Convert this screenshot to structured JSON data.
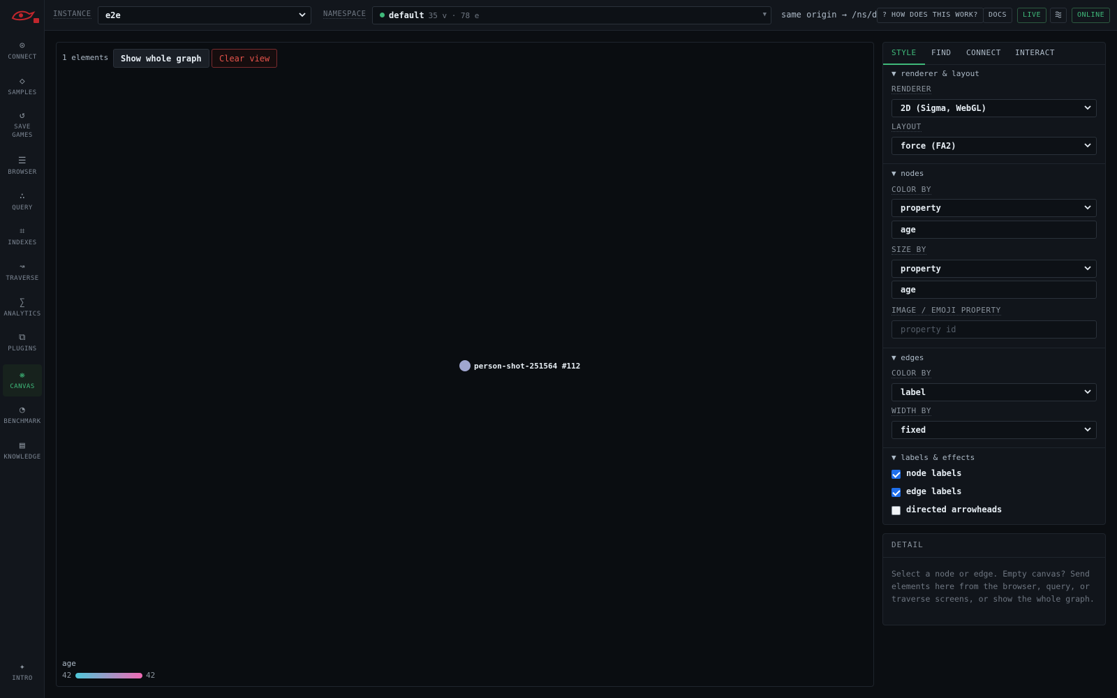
{
  "sidebar": {
    "items": [
      {
        "label": "CONNECT",
        "icon": "target-icon"
      },
      {
        "label": "SAMPLES",
        "icon": "diamond-icon"
      },
      {
        "label": "SAVE GAMES",
        "icon": "refresh-icon"
      },
      {
        "label": "BROWSER",
        "icon": "list-icon"
      },
      {
        "label": "QUERY",
        "icon": "dots-icon"
      },
      {
        "label": "INDEXES",
        "icon": "frame-icon"
      },
      {
        "label": "TRAVERSE",
        "icon": "squiggle-icon"
      },
      {
        "label": "ANALYTICS",
        "icon": "sigma-icon"
      },
      {
        "label": "PLUGINS",
        "icon": "copy-icon"
      },
      {
        "label": "CANVAS",
        "icon": "canvas-icon"
      },
      {
        "label": "BENCHMARK",
        "icon": "gauge-icon"
      },
      {
        "label": "KNOWLEDGE",
        "icon": "book-icon"
      }
    ],
    "intro": {
      "label": "INTRO",
      "icon": "sparkle-icon"
    }
  },
  "topbar": {
    "instance_label": "INSTANCE",
    "instance_value": "e2e",
    "namespace_label": "NAMESPACE",
    "namespace_value": "default",
    "namespace_counts": "35 v · 78 e",
    "origin": "same origin → /ns/default/*",
    "help": "? HOW DOES THIS WORK?",
    "docs": "DOCS",
    "live": "LIVE",
    "online": "ONLINE",
    "accent": "#3fb97a"
  },
  "canvas": {
    "element_count": "1 elements",
    "show_whole_graph": "Show whole graph",
    "clear_view": "Clear view",
    "node_label": "person-shot-251564 #112",
    "legend": {
      "title": "age",
      "min": "42",
      "max": "42"
    }
  },
  "panel": {
    "tabs": [
      "STYLE",
      "FIND",
      "CONNECT",
      "INTERACT"
    ],
    "active_tab": "STYLE",
    "renderer_section": "▼ renderer & layout",
    "renderer_label": "RENDERER",
    "renderer_value": "2D (Sigma, WebGL)",
    "layout_label": "LAYOUT",
    "layout_value": "force (FA2)",
    "nodes_section": "▼ nodes",
    "node_color_by_label": "COLOR BY",
    "node_color_by_value": "property",
    "node_color_prop": "age",
    "node_size_by_label": "SIZE BY",
    "node_size_by_value": "property",
    "node_size_prop": "age",
    "image_label": "IMAGE / EMOJI PROPERTY",
    "image_placeholder": "property id",
    "edges_section": "▼ edges",
    "edge_color_by_label": "COLOR BY",
    "edge_color_by_value": "label",
    "edge_width_by_label": "WIDTH BY",
    "edge_width_by_value": "fixed",
    "labels_section": "▼ labels & effects",
    "checks": [
      {
        "label": "node labels",
        "checked": true
      },
      {
        "label": "edge labels",
        "checked": true
      },
      {
        "label": "directed arrowheads",
        "checked": false
      }
    ]
  },
  "detail": {
    "title": "DETAIL",
    "text": "Select a node or edge. Empty canvas? Send elements here from the browser, query, or traverse screens, or show the whole graph."
  }
}
